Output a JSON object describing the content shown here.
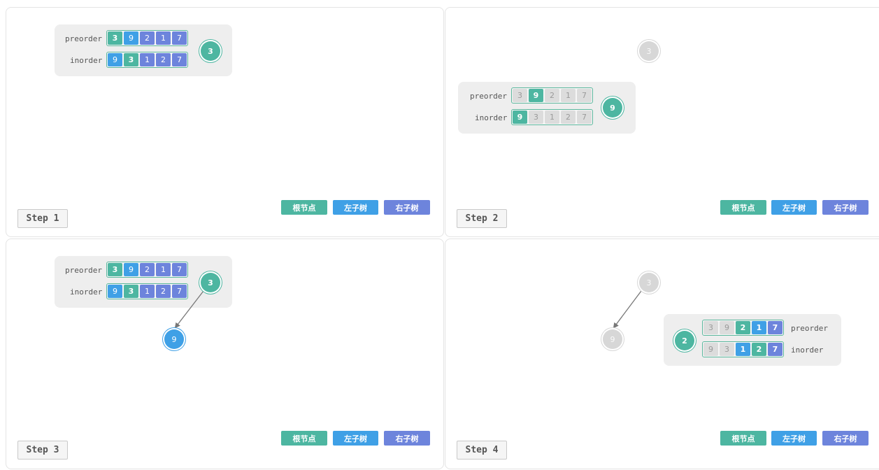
{
  "labels": {
    "preorder": "preorder",
    "inorder": "inorder"
  },
  "legend": {
    "root": "根节点",
    "left": "左子树",
    "right": "右子树"
  },
  "colors": {
    "root": "#4db6a1",
    "left": "#3fa0e6",
    "right": "#6d84dc",
    "dim": "#dcdcdc"
  },
  "steps": [
    {
      "label": "Step 1",
      "preorder": [
        "3",
        "9",
        "2",
        "1",
        "7"
      ],
      "inorder": [
        "9",
        "3",
        "1",
        "2",
        "7"
      ],
      "current_node": "3",
      "tree_nodes": []
    },
    {
      "label": "Step 2",
      "preorder": [
        "3",
        "9",
        "2",
        "1",
        "7"
      ],
      "inorder": [
        "9",
        "3",
        "1",
        "2",
        "7"
      ],
      "current_node": "9",
      "tree_nodes": [
        "3"
      ]
    },
    {
      "label": "Step 3",
      "preorder": [
        "3",
        "9",
        "2",
        "1",
        "7"
      ],
      "inorder": [
        "9",
        "3",
        "1",
        "2",
        "7"
      ],
      "current_node": "3",
      "tree_nodes": [
        "9"
      ]
    },
    {
      "label": "Step 4",
      "preorder": [
        "3",
        "9",
        "2",
        "1",
        "7"
      ],
      "inorder": [
        "9",
        "3",
        "1",
        "2",
        "7"
      ],
      "current_node": "2",
      "tree_nodes": [
        "3",
        "9"
      ]
    }
  ]
}
